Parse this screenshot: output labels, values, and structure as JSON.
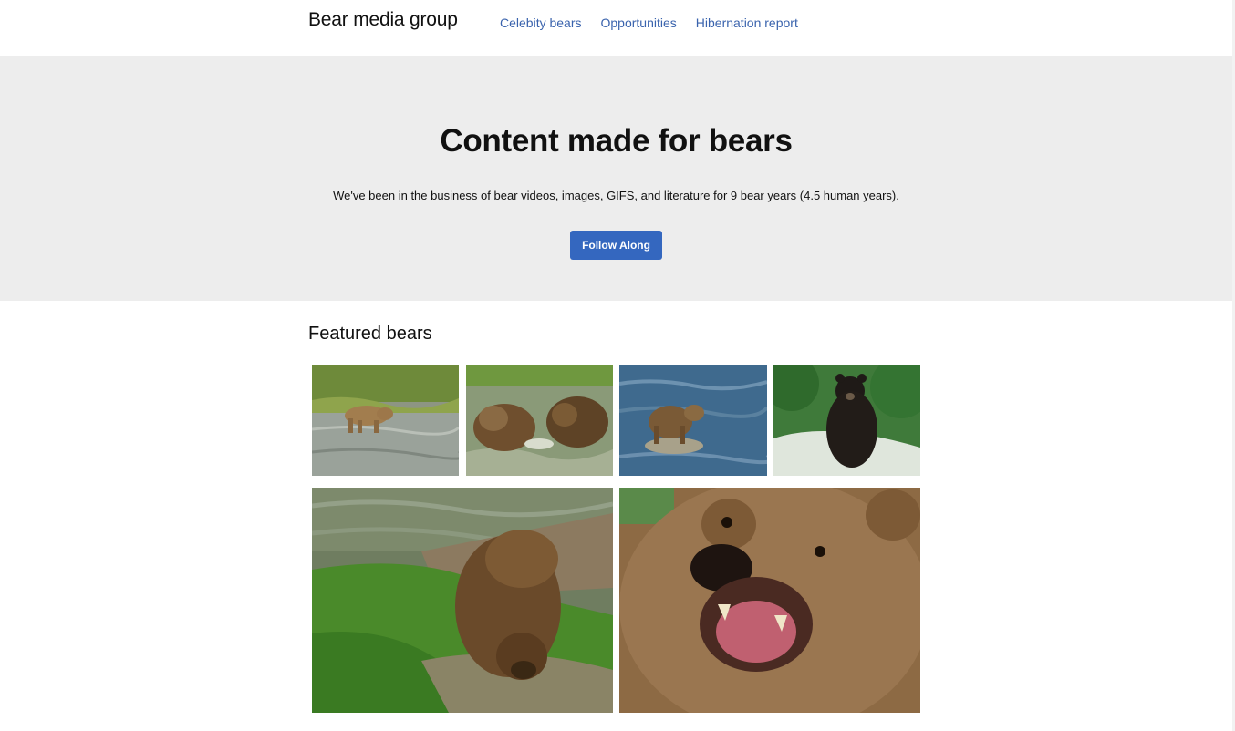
{
  "header": {
    "brand": "Bear media group",
    "nav": [
      {
        "label": "Celebity bears"
      },
      {
        "label": "Opportunities"
      },
      {
        "label": "Hibernation report"
      }
    ]
  },
  "hero": {
    "title": "Content made for bears",
    "text": "We've been in the business of bear videos, images, GIFS, and literature for 9 bear years (4.5 human years).",
    "button_label": "Follow Along"
  },
  "featured": {
    "heading": "Featured bears"
  },
  "colors": {
    "accent": "#3467bf",
    "link": "#3a63ad",
    "hero_bg": "#ededed"
  }
}
